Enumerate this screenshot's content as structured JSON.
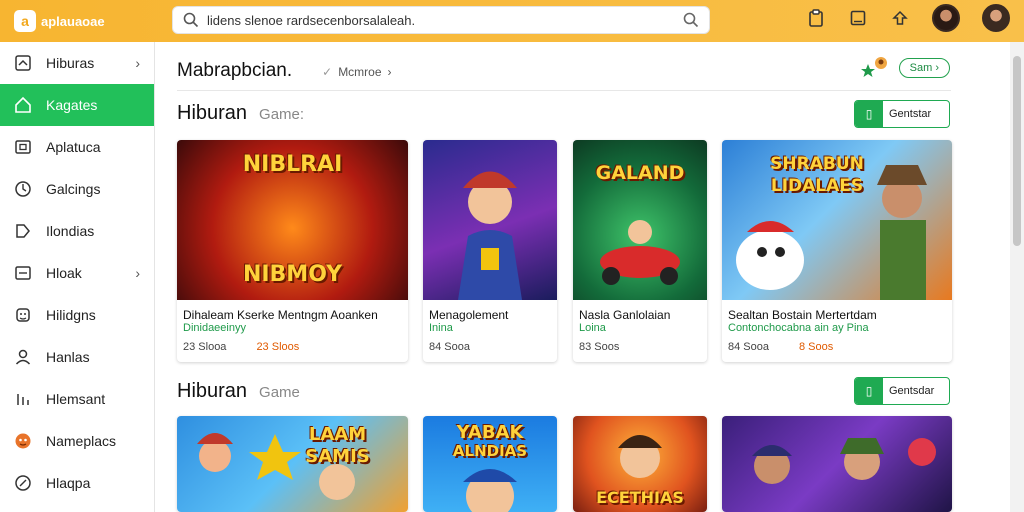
{
  "header": {
    "logo_mark": "a",
    "logo_text": "aplauaoae",
    "search_value": "lidens slenoe rardsecenborsalaleah.",
    "icons": [
      "clipboard-icon",
      "tablet-icon",
      "upload-icon",
      "avatar",
      "avatar"
    ]
  },
  "sidebar": {
    "items": [
      {
        "label": "Hiburas",
        "icon": "home-icon",
        "chevron": "›",
        "active": false
      },
      {
        "label": "Kagates",
        "icon": "home-icon",
        "chevron": "",
        "active": true
      },
      {
        "label": "Aplatuca",
        "icon": "screen-icon",
        "chevron": "",
        "active": false
      },
      {
        "label": "Galcings",
        "icon": "compass-icon",
        "chevron": "",
        "active": false
      },
      {
        "label": "Ilondias",
        "icon": "tag-icon",
        "chevron": "",
        "active": false
      },
      {
        "label": "Hloak",
        "icon": "box-icon",
        "chevron": "›",
        "active": false
      },
      {
        "label": "Hilidgns",
        "icon": "gamepad-icon",
        "chevron": "",
        "active": false
      },
      {
        "label": "Hanlas",
        "icon": "user-icon",
        "chevron": "",
        "active": false
      },
      {
        "label": "Hlemsant",
        "icon": "chart-icon",
        "chevron": "",
        "active": false
      },
      {
        "label": "Nameplacs",
        "icon": "character-icon",
        "chevron": "",
        "active": false
      },
      {
        "label": "Hlaqpa",
        "icon": "globe-icon",
        "chevron": "",
        "active": false
      }
    ]
  },
  "main": {
    "page_title": "Mabrapbcian.",
    "crumb_check": "✓",
    "crumb": "Mcmroe",
    "crumb_chev": "›",
    "pill_label": "Sam",
    "pill_chev": "›",
    "sections": [
      {
        "title": "Hiburan",
        "subtitle": "Game:",
        "button_label": "Gentstar",
        "cards": [
          {
            "art_title": "NIBLRAI",
            "art_title2": "NIBMOY",
            "name": "Dihaleam Kserke Mentngm Aoanken",
            "name2": "Dinidaeeinyy",
            "meta1": "23 Slooa",
            "meta2": "23 Sloos"
          },
          {
            "art_title": "",
            "art_title2": "",
            "name": "Menagolement",
            "name2": "Inina",
            "meta1": "84 Sooa",
            "meta2": ""
          },
          {
            "art_title": "GALAND",
            "art_title2": "",
            "name": "Nasla Ganlolaian",
            "name2": "Loina",
            "meta1": "83 Soos",
            "meta2": ""
          },
          {
            "art_title": "SHRABUN",
            "art_title2": "LIDALAES",
            "name": "Sealtan Bostain Mertertdam",
            "name2": "Contonchocabna ain ay Pina",
            "meta1": "84 Sooa",
            "meta2": "8 Soos"
          }
        ]
      },
      {
        "title": "Hiburan",
        "subtitle": "Game",
        "button_label": "Gentsdar",
        "cards": [
          {
            "art_title": "LAAM",
            "art_title2": "SAMIS",
            "name": "",
            "name2": "",
            "meta1": "",
            "meta2": ""
          },
          {
            "art_title": "YABAK",
            "art_title2": "ALNDIAS",
            "name": "",
            "name2": "",
            "meta1": "",
            "meta2": ""
          },
          {
            "art_title": "ECETHIAS",
            "art_title2": "",
            "name": "",
            "name2": "",
            "meta1": "",
            "meta2": ""
          },
          {
            "art_title": "",
            "art_title2": "",
            "name": "",
            "name2": "",
            "meta1": "",
            "meta2": ""
          }
        ]
      }
    ]
  },
  "colors": {
    "accent": "#22c05a",
    "topbar": "#f7b531",
    "hot": "#e05a00"
  }
}
